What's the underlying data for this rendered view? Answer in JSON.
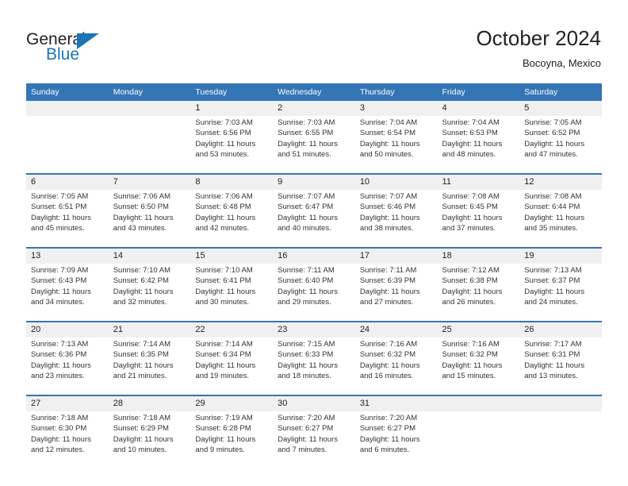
{
  "logo": {
    "word_one": "General",
    "word_two": "Blue",
    "triangle_color": "#1b75bb"
  },
  "header": {
    "title": "October 2024",
    "subtitle": "Bocoyna, Mexico",
    "accent_color": "#3375b5",
    "daynum_band_color": "#f0f0f0"
  },
  "weekdays": [
    "Sunday",
    "Monday",
    "Tuesday",
    "Wednesday",
    "Thursday",
    "Friday",
    "Saturday"
  ],
  "weeks": [
    {
      "days": [
        {
          "num": "",
          "lines": []
        },
        {
          "num": "",
          "lines": []
        },
        {
          "num": "1",
          "lines": [
            "Sunrise: 7:03 AM",
            "Sunset: 6:56 PM",
            "Daylight: 11 hours",
            "and 53 minutes."
          ]
        },
        {
          "num": "2",
          "lines": [
            "Sunrise: 7:03 AM",
            "Sunset: 6:55 PM",
            "Daylight: 11 hours",
            "and 51 minutes."
          ]
        },
        {
          "num": "3",
          "lines": [
            "Sunrise: 7:04 AM",
            "Sunset: 6:54 PM",
            "Daylight: 11 hours",
            "and 50 minutes."
          ]
        },
        {
          "num": "4",
          "lines": [
            "Sunrise: 7:04 AM",
            "Sunset: 6:53 PM",
            "Daylight: 11 hours",
            "and 48 minutes."
          ]
        },
        {
          "num": "5",
          "lines": [
            "Sunrise: 7:05 AM",
            "Sunset: 6:52 PM",
            "Daylight: 11 hours",
            "and 47 minutes."
          ]
        }
      ]
    },
    {
      "days": [
        {
          "num": "6",
          "lines": [
            "Sunrise: 7:05 AM",
            "Sunset: 6:51 PM",
            "Daylight: 11 hours",
            "and 45 minutes."
          ]
        },
        {
          "num": "7",
          "lines": [
            "Sunrise: 7:06 AM",
            "Sunset: 6:50 PM",
            "Daylight: 11 hours",
            "and 43 minutes."
          ]
        },
        {
          "num": "8",
          "lines": [
            "Sunrise: 7:06 AM",
            "Sunset: 6:48 PM",
            "Daylight: 11 hours",
            "and 42 minutes."
          ]
        },
        {
          "num": "9",
          "lines": [
            "Sunrise: 7:07 AM",
            "Sunset: 6:47 PM",
            "Daylight: 11 hours",
            "and 40 minutes."
          ]
        },
        {
          "num": "10",
          "lines": [
            "Sunrise: 7:07 AM",
            "Sunset: 6:46 PM",
            "Daylight: 11 hours",
            "and 38 minutes."
          ]
        },
        {
          "num": "11",
          "lines": [
            "Sunrise: 7:08 AM",
            "Sunset: 6:45 PM",
            "Daylight: 11 hours",
            "and 37 minutes."
          ]
        },
        {
          "num": "12",
          "lines": [
            "Sunrise: 7:08 AM",
            "Sunset: 6:44 PM",
            "Daylight: 11 hours",
            "and 35 minutes."
          ]
        }
      ]
    },
    {
      "days": [
        {
          "num": "13",
          "lines": [
            "Sunrise: 7:09 AM",
            "Sunset: 6:43 PM",
            "Daylight: 11 hours",
            "and 34 minutes."
          ]
        },
        {
          "num": "14",
          "lines": [
            "Sunrise: 7:10 AM",
            "Sunset: 6:42 PM",
            "Daylight: 11 hours",
            "and 32 minutes."
          ]
        },
        {
          "num": "15",
          "lines": [
            "Sunrise: 7:10 AM",
            "Sunset: 6:41 PM",
            "Daylight: 11 hours",
            "and 30 minutes."
          ]
        },
        {
          "num": "16",
          "lines": [
            "Sunrise: 7:11 AM",
            "Sunset: 6:40 PM",
            "Daylight: 11 hours",
            "and 29 minutes."
          ]
        },
        {
          "num": "17",
          "lines": [
            "Sunrise: 7:11 AM",
            "Sunset: 6:39 PM",
            "Daylight: 11 hours",
            "and 27 minutes."
          ]
        },
        {
          "num": "18",
          "lines": [
            "Sunrise: 7:12 AM",
            "Sunset: 6:38 PM",
            "Daylight: 11 hours",
            "and 26 minutes."
          ]
        },
        {
          "num": "19",
          "lines": [
            "Sunrise: 7:13 AM",
            "Sunset: 6:37 PM",
            "Daylight: 11 hours",
            "and 24 minutes."
          ]
        }
      ]
    },
    {
      "days": [
        {
          "num": "20",
          "lines": [
            "Sunrise: 7:13 AM",
            "Sunset: 6:36 PM",
            "Daylight: 11 hours",
            "and 23 minutes."
          ]
        },
        {
          "num": "21",
          "lines": [
            "Sunrise: 7:14 AM",
            "Sunset: 6:35 PM",
            "Daylight: 11 hours",
            "and 21 minutes."
          ]
        },
        {
          "num": "22",
          "lines": [
            "Sunrise: 7:14 AM",
            "Sunset: 6:34 PM",
            "Daylight: 11 hours",
            "and 19 minutes."
          ]
        },
        {
          "num": "23",
          "lines": [
            "Sunrise: 7:15 AM",
            "Sunset: 6:33 PM",
            "Daylight: 11 hours",
            "and 18 minutes."
          ]
        },
        {
          "num": "24",
          "lines": [
            "Sunrise: 7:16 AM",
            "Sunset: 6:32 PM",
            "Daylight: 11 hours",
            "and 16 minutes."
          ]
        },
        {
          "num": "25",
          "lines": [
            "Sunrise: 7:16 AM",
            "Sunset: 6:32 PM",
            "Daylight: 11 hours",
            "and 15 minutes."
          ]
        },
        {
          "num": "26",
          "lines": [
            "Sunrise: 7:17 AM",
            "Sunset: 6:31 PM",
            "Daylight: 11 hours",
            "and 13 minutes."
          ]
        }
      ]
    },
    {
      "days": [
        {
          "num": "27",
          "lines": [
            "Sunrise: 7:18 AM",
            "Sunset: 6:30 PM",
            "Daylight: 11 hours",
            "and 12 minutes."
          ]
        },
        {
          "num": "28",
          "lines": [
            "Sunrise: 7:18 AM",
            "Sunset: 6:29 PM",
            "Daylight: 11 hours",
            "and 10 minutes."
          ]
        },
        {
          "num": "29",
          "lines": [
            "Sunrise: 7:19 AM",
            "Sunset: 6:28 PM",
            "Daylight: 11 hours",
            "and 9 minutes."
          ]
        },
        {
          "num": "30",
          "lines": [
            "Sunrise: 7:20 AM",
            "Sunset: 6:27 PM",
            "Daylight: 11 hours",
            "and 7 minutes."
          ]
        },
        {
          "num": "31",
          "lines": [
            "Sunrise: 7:20 AM",
            "Sunset: 6:27 PM",
            "Daylight: 11 hours",
            "and 6 minutes."
          ]
        },
        {
          "num": "",
          "lines": []
        },
        {
          "num": "",
          "lines": []
        }
      ]
    }
  ]
}
